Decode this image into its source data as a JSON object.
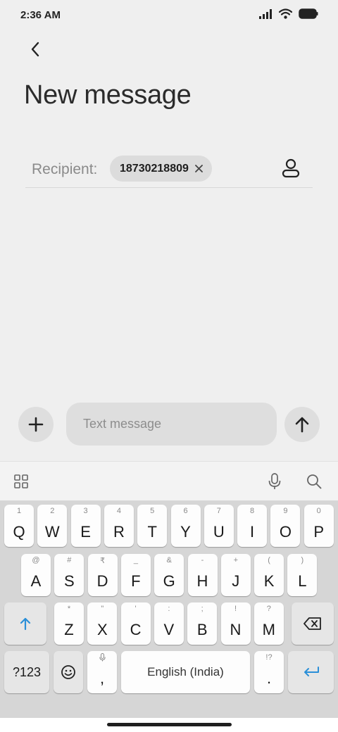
{
  "status_bar": {
    "time": "2:36 AM"
  },
  "header": {
    "title": "New message"
  },
  "recipient": {
    "label": "Recipient:",
    "number": "18730218809"
  },
  "composer": {
    "placeholder": "Text message"
  },
  "keyboard": {
    "row1": [
      {
        "main": "Q",
        "hint": "1"
      },
      {
        "main": "W",
        "hint": "2"
      },
      {
        "main": "E",
        "hint": "3"
      },
      {
        "main": "R",
        "hint": "4"
      },
      {
        "main": "T",
        "hint": "5"
      },
      {
        "main": "Y",
        "hint": "6"
      },
      {
        "main": "U",
        "hint": "7"
      },
      {
        "main": "I",
        "hint": "8"
      },
      {
        "main": "O",
        "hint": "9"
      },
      {
        "main": "P",
        "hint": "0"
      }
    ],
    "row2": [
      {
        "main": "A",
        "hint": "@"
      },
      {
        "main": "S",
        "hint": "#"
      },
      {
        "main": "D",
        "hint": "₹"
      },
      {
        "main": "F",
        "hint": "_"
      },
      {
        "main": "G",
        "hint": "&"
      },
      {
        "main": "H",
        "hint": "-"
      },
      {
        "main": "J",
        "hint": "+"
      },
      {
        "main": "K",
        "hint": "("
      },
      {
        "main": "L",
        "hint": ")"
      }
    ],
    "row3": [
      {
        "main": "Z",
        "hint": "*"
      },
      {
        "main": "X",
        "hint": "\""
      },
      {
        "main": "C",
        "hint": "'"
      },
      {
        "main": "V",
        "hint": ":"
      },
      {
        "main": "B",
        "hint": ";"
      },
      {
        "main": "N",
        "hint": "!"
      },
      {
        "main": "M",
        "hint": "?"
      }
    ],
    "symbols_label": "?123",
    "comma": ",",
    "space_label": "English (India)",
    "period": ".",
    "period_hint": "!?"
  },
  "colors": {
    "accent": "#2a8fd8",
    "background": "#efefef"
  }
}
